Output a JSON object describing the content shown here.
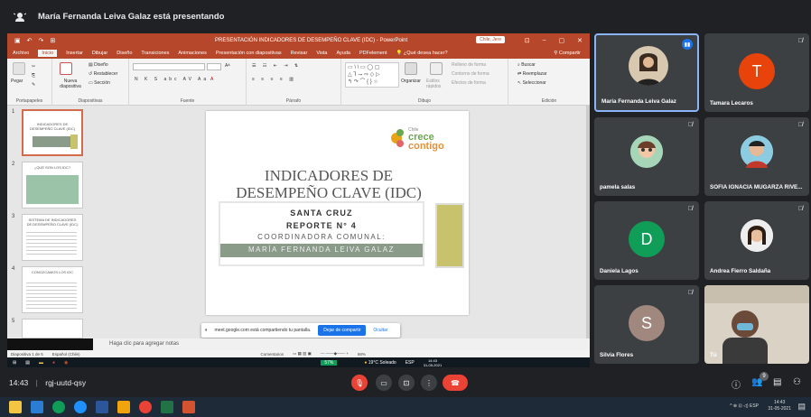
{
  "presenting_banner": "María Fernanda Leiva Galaz está presentando",
  "powerpoint": {
    "title": "PRESENTACIÓN INDICADORES DE DESEMPEÑO CLAVE (IDC) - PowerPoint",
    "user_pill": "Chile, Jere",
    "tabs": [
      "Archivo",
      "Inicio",
      "Insertar",
      "Dibujar",
      "Diseño",
      "Transiciones",
      "Animaciones",
      "Presentación con diapositivas",
      "Revisar",
      "Vista",
      "Ayuda",
      "PDFelement",
      "¿Qué desea hacer?"
    ],
    "share_label": "Compartir",
    "ribbon": {
      "portapapeles": "Portapapeles",
      "pegar": "Pegar",
      "diapositivas": "Diapositivas",
      "nueva": "Nueva diapositiva",
      "diseno": "Diseño",
      "restablecer": "Restablecer",
      "seccion": "Sección",
      "fuente": "Fuente",
      "parrafo": "Párrafo",
      "dibujo": "Dibujo",
      "organizar": "Organizar",
      "estilos": "Estilos rápidos",
      "relleno": "Relleno de forma",
      "contorno": "Contorno de forma",
      "efectos": "Efectos de forma",
      "buscar": "Buscar",
      "reemplazar": "Reemplazar",
      "seleccionar": "Seleccionar",
      "edicion": "Edición"
    },
    "thumb_numbers": [
      "1",
      "2",
      "3",
      "4",
      "5"
    ],
    "thumb1_text": "INDICADORES DE DESEMPEÑO CLAVE (IDC)",
    "thumb2_text": "¿QUÉ SON LOS IDC?",
    "thumb3_text": "SISTEMA DE INDICADORES DE DESEMPEÑO CLAVE (IDC)",
    "thumb4_text": "CONOZCAMOS LOS IDC",
    "slide": {
      "title": "INDICADORES DE DESEMPEÑO CLAVE (IDC)",
      "line1": "SANTA CRUZ",
      "line2": "REPORTE N° 4",
      "line3": "COORDINADORA COMUNAL:",
      "line4": "MARÍA FERNANDA LEIVA GALAZ",
      "logo_line1": "Chile",
      "logo_line2": "crece",
      "logo_line3": "contigo"
    },
    "notes_placeholder": "Haga clic para agregar notas",
    "status_slide": "Diapositiva 1 de 5",
    "status_lang": "Español (Chile)",
    "status_comments": "Comentarios",
    "zoom": "68%",
    "inner_weather": "19°C Soleado",
    "inner_time": "14:43",
    "inner_date": "31-05-2021",
    "inner_lang": "ESP",
    "inner_battery": "57%"
  },
  "meet_share_bar": {
    "text": "meet.google.com está compartiendo tu pantalla.",
    "stop": "Dejar de compartir",
    "hide": "Ocultar"
  },
  "participants": [
    {
      "name": "María Fernanda Leiva Galaz",
      "initial": "",
      "color": "#3c4043"
    },
    {
      "name": "Tamara Lecaros",
      "initial": "T",
      "color": "#e8430a"
    },
    {
      "name": "pamela salas",
      "initial": "",
      "color": "#3c4043"
    },
    {
      "name": "SOFIA IGNACIA MUGARZA RIVE...",
      "initial": "",
      "color": "#3c4043"
    },
    {
      "name": "Daniela Lagos",
      "initial": "D",
      "color": "#0f9d58"
    },
    {
      "name": "Andrea Fierro Saldaña",
      "initial": "",
      "color": "#3c4043"
    },
    {
      "name": "Silvia Flores",
      "initial": "S",
      "color": "#a1887f"
    },
    {
      "name": "Tú",
      "initial": "",
      "color": "#3c4043"
    }
  ],
  "meeting": {
    "time": "14:43",
    "separator": "|",
    "code": "rgj-uutd-qsy",
    "people_count": "9"
  },
  "taskbar": {
    "time": "14:43",
    "date": "31-05-2021",
    "lang": "ESP"
  },
  "colors": {
    "ppt_accent": "#b7472a",
    "meet_bg": "#202124",
    "end_call": "#ea4335",
    "mic_off": "#ea4335"
  }
}
